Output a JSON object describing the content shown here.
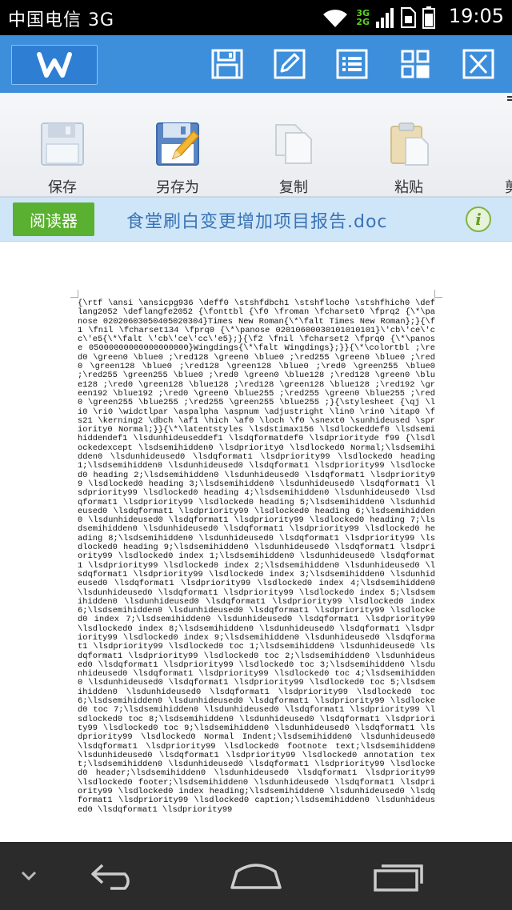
{
  "status_bar": {
    "carrier": "中国电信 3G",
    "network_top": "3G",
    "network_bottom": "2G",
    "time": "19:05"
  },
  "toolbar": {
    "logo_icon": "wps-logo-icon",
    "icons": [
      "save-disk-icon",
      "edit-pencil-icon",
      "list-icon",
      "grid-icon",
      "close-icon"
    ]
  },
  "ribbon": {
    "items": [
      {
        "label": "保存",
        "icon": "save-icon"
      },
      {
        "label": "另存为",
        "icon": "save-as-icon"
      },
      {
        "label": "复制",
        "icon": "copy-icon"
      },
      {
        "label": "粘贴",
        "icon": "paste-icon"
      },
      {
        "label": "剪",
        "icon": "cut-icon"
      }
    ]
  },
  "reader_bar": {
    "reader_button": "阅读器",
    "document_title": "食堂刷白变更增加项目报告.doc",
    "info_icon": "i"
  },
  "document": {
    "content": "{\\rtf \\ansi \\ansicpg936 \\deff0 \\stshfdbch1 \\stshfloch0 \\stshfhich0 \\deflang2052 \\deflangfe2052 {\\fonttbl {\\f0 \\froman \\fcharset0 \\fprq2 {\\*\\panose 02020603050405020304}Times New Roman{\\*\\falt Times New Roman};}{\\f1 \\fnil \\fcharset134 \\fprq0 {\\*\\panose 02010600030101010101}\\'cb\\'ce\\'cc\\'e5{\\*\\falt \\'cb\\'ce\\'cc\\'e5};}{\\f2 \\fnil \\fcharset2 \\fprq0 {\\*\\panose 05000000000000000000}Wingdings{\\*\\falt Wingdings};}}{\\*\\colortbl ;\\red0 \\green0 \\blue0 ;\\red128 \\green0 \\blue0 ;\\red255 \\green0 \\blue0 ;\\red0 \\green128 \\blue0 ;\\red128 \\green128 \\blue0 ;\\red0 \\green255 \\blue0 ;\\red255 \\green255 \\blue0 ;\\red0 \\green0 \\blue128 ;\\red128 \\green0 \\blue128 ;\\red0 \\green128 \\blue128 ;\\red128 \\green128 \\blue128 ;\\red192 \\green192 \\blue192 ;\\red0 \\green0 \\blue255 ;\\red255 \\green0 \\blue255 ;\\red0 \\green255 \\blue255 ;\\red255 \\green255 \\blue255 ;}{\\stylesheet {\\qj \\li0 \\ri0 \\widctlpar \\aspalpha \\aspnum \\adjustright \\lin0 \\rin0 \\itap0 \\fs21 \\kerning2 \\dbch \\af1 \\hich \\af0 \\loch \\f0 \\snext0 \\sunhideused \\spriority0 Normal;}}{\\*\\latentstyles \\lsdstimax156 \\lsdlockeddef0 \\lsdsemihiddendef1 \\lsdunhideuseddef1 \\lsdqformatdef0 \\lsdpriorityde f99 {\\lsdlockedexcept \\lsdsemihidden0 \\lsdpriority0 \\lsdlocked0 Normal;\\lsdsemihidden0 \\lsdunhideused0 \\lsdqformat1 \\lsdpriority99 \\lsdlocked0 heading 1;\\lsdsemihidden0 \\lsdunhideused0 \\lsdqformat1 \\lsdpriority99 \\lsdlocked0 heading 2;\\lsdsemihidden0 \\lsdunhideused0 \\lsdqformat1 \\lsdpriority99 \\lsdlocked0 heading 3;\\lsdsemihidden0 \\lsdunhideused0 \\lsdqformat1 \\lsdpriority99 \\lsdlocked0 heading 4;\\lsdsemihidden0 \\lsdunhideused0 \\lsdqformat1 \\lsdpriority99 \\lsdlocked0 heading 5;\\lsdsemihidden0 \\lsdunhideused0 \\lsdqformat1 \\lsdpriority99 \\lsdlocked0 heading 6;\\lsdsemihidden0 \\lsdunhideused0 \\lsdqformat1 \\lsdpriority99 \\lsdlocked0 heading 7;\\lsdsemihidden0 \\lsdunhideused0 \\lsdqformat1 \\lsdpriority99 \\lsdlocked0 heading 8;\\lsdsemihidden0 \\lsdunhideused0 \\lsdqformat1 \\lsdpriority99 \\lsdlocked0 heading 9;\\lsdsemihidden0 \\lsdunhideused0 \\lsdqformat1 \\lsdpriority99 \\lsdlocked0 index 1;\\lsdsemihidden0 \\lsdunhideused0 \\lsdqformat1 \\lsdpriority99 \\lsdlocked0 index 2;\\lsdsemihidden0 \\lsdunhideused0 \\lsdqformat1 \\lsdpriority99 \\lsdlocked0 index 3;\\lsdsemihidden0 \\lsdunhideused0 \\lsdqformat1 \\lsdpriority99 \\lsdlocked0 index 4;\\lsdsemihidden0 \\lsdunhideused0 \\lsdqformat1 \\lsdpriority99 \\lsdlocked0 index 5;\\lsdsemihidden0 \\lsdunhideused0 \\lsdqformat1 \\lsdpriority99 \\lsdlocked0 index 6;\\lsdsemihidden0 \\lsdunhideused0 \\lsdqformat1 \\lsdpriority99 \\lsdlocked0 index 7;\\lsdsemihidden0 \\lsdunhideused0 \\lsdqformat1 \\lsdpriority99 \\lsdlocked0 index 8;\\lsdsemihidden0 \\lsdunhideused0 \\lsdqformat1 \\lsdpriority99 \\lsdlocked0 index 9;\\lsdsemihidden0 \\lsdunhideused0 \\lsdqformat1 \\lsdpriority99 \\lsdlocked0 toc 1;\\lsdsemihidden0 \\lsdunhideused0 \\lsdqformat1 \\lsdpriority99 \\lsdlocked0 toc 2;\\lsdsemihidden0 \\lsdunhideused0 \\lsdqformat1 \\lsdpriority99 \\lsdlocked0 toc 3;\\lsdsemihidden0 \\lsdunhideused0 \\lsdqformat1 \\lsdpriority99 \\lsdlocked0 toc 4;\\lsdsemihidden0 \\lsdunhideused0 \\lsdqformat1 \\lsdpriority99 \\lsdlocked0 toc 5;\\lsdsemihidden0 \\lsdunhideused0 \\lsdqformat1 \\lsdpriority99 \\lsdlocked0 toc 6;\\lsdsemihidden0 \\lsdunhideused0 \\lsdqformat1 \\lsdpriority99 \\lsdlocked0 toc 7;\\lsdsemihidden0 \\lsdunhideused0 \\lsdqformat1 \\lsdpriority99 \\lsdlocked0 toc 8;\\lsdsemihidden0 \\lsdunhideused0 \\lsdqformat1 \\lsdpriority99 \\lsdlocked0 toc 9;\\lsdsemihidden0 \\lsdunhideused0 \\lsdqformat1 \\lsdpriority99 \\lsdlocked0 Normal Indent;\\lsdsemihidden0 \\lsdunhideused0 \\lsdqformat1 \\lsdpriority99 \\lsdlocked0 footnote text;\\lsdsemihidden0 \\lsdunhideused0 \\lsdqformat1 \\lsdpriority99 \\lsdlocked0 annotation text;\\lsdsemihidden0 \\lsdunhideused0 \\lsdqformat1 \\lsdpriority99 \\lsdlocked0 header;\\lsdsemihidden0 \\lsdunhideused0 \\lsdqformat1 \\lsdpriority99 \\lsdlocked0 footer;\\lsdsemihidden0 \\lsdunhideused0 \\lsdqformat1 \\lsdpriority99 \\lsdlocked0 index heading;\\lsdsemihidden0 \\lsdunhideused0 \\lsdqformat1 \\lsdpriority99 \\lsdlocked0 caption;\\lsdsemihidden0 \\lsdunhideused0 \\lsdqformat1 \\lsdpriority99"
  },
  "nav_bar": {
    "icons": [
      "chevron-down-icon",
      "back-icon",
      "home-icon",
      "recent-apps-icon"
    ]
  }
}
